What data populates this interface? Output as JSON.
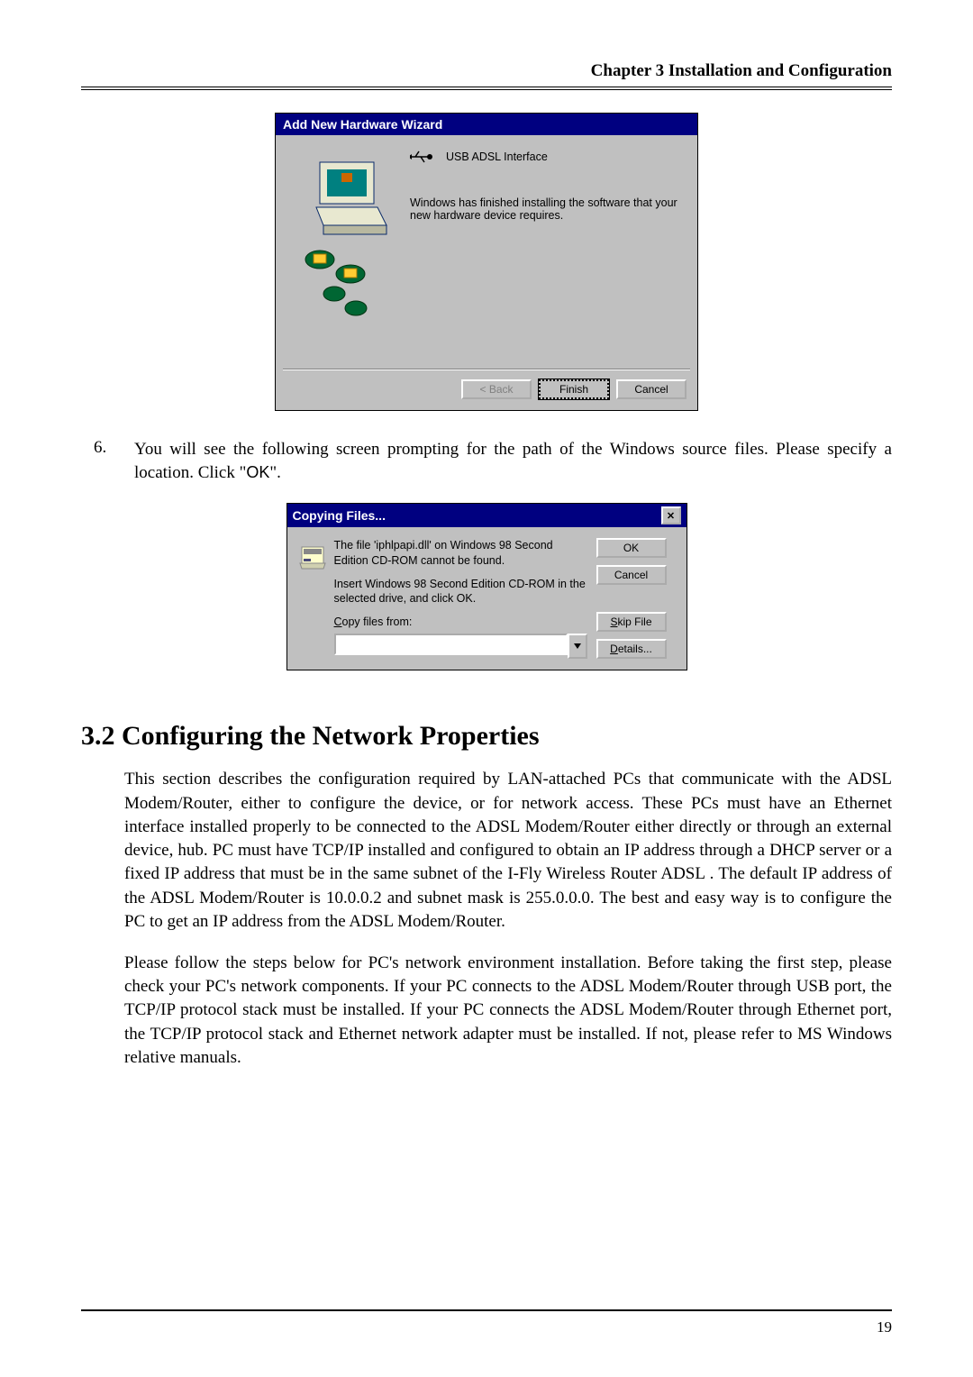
{
  "header": {
    "chapter_line": "Chapter 3 Installation and Configuration"
  },
  "wizard": {
    "title": "Add New Hardware Wizard",
    "device_name": "USB ADSL Interface",
    "body_text": "Windows has finished installing the software that your new hardware device requires.",
    "btn_back": "< Back",
    "btn_finish": "Finish",
    "btn_cancel": "Cancel"
  },
  "step6": {
    "num": "6.",
    "text_before_ok": "You will see the following screen prompting for the path of the Windows source files. Please specify a location. Click \"",
    "ok_word": "OK",
    "text_after_ok": "\"."
  },
  "copy_dlg": {
    "title": "Copying Files...",
    "msg1": "The file 'iphlpapi.dll' on Windows 98 Second Edition CD-ROM cannot be found.",
    "msg2": "Insert Windows 98 Second Edition CD-ROM in the selected drive, and click OK.",
    "copy_label_pre": "C",
    "copy_label_rest": "opy files from:",
    "btn_ok": "OK",
    "btn_cancel": "Cancel",
    "btn_skip_pre": "S",
    "btn_skip_rest": "kip File",
    "btn_details_pre": "D",
    "btn_details_rest": "etails..."
  },
  "section": {
    "heading": "3.2 Configuring the Network Properties",
    "para1": "This section describes the configuration required by LAN-attached PCs that communicate with the ADSL Modem/Router, either to configure the device, or for network access. These PCs must have an Ethernet interface installed properly to be connected to the ADSL Modem/Router either directly or through an external device, hub. PC must have TCP/IP installed and configured to obtain an IP address through a DHCP server or a fixed IP address that must be in the same subnet of the I-Fly Wireless Router ADSL . The default IP address of the ADSL Modem/Router is 10.0.0.2 and subnet mask is 255.0.0.0. The best and easy way is to configure the PC to get an IP address from the ADSL Modem/Router.",
    "para2": "Please follow the steps below for PC's network environment installation. Before taking the first step, please check your PC's network components. If your PC connects to the ADSL Modem/Router through USB port, the TCP/IP protocol stack must be installed. If your PC connects the ADSL Modem/Router through Ethernet port, the TCP/IP protocol stack and Ethernet network adapter must be installed. If not, please refer to MS Windows relative manuals."
  },
  "footer": {
    "pagenum": "19"
  }
}
